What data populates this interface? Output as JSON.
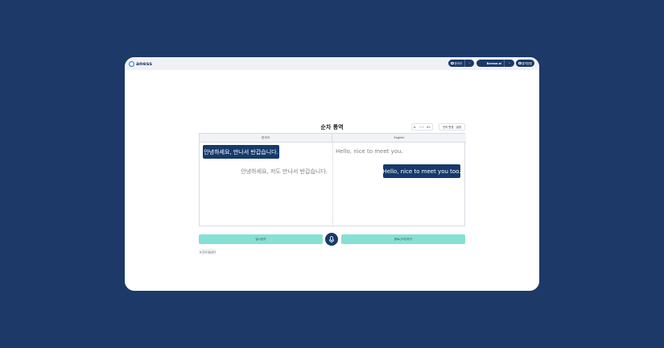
{
  "app": {
    "logo_text": "aness",
    "title": "순차 통역"
  },
  "header": {
    "language_label": "한국어",
    "user_label": "Boreoe.ai",
    "guide_label": "통역방법"
  },
  "controls": {
    "font_decrease": "A-",
    "font_mid": "100",
    "font_increase": "A+",
    "language_change": "언어 변경 · 설정"
  },
  "panel": {
    "left_header": "한국어",
    "right_header": "English",
    "messages": [
      {
        "side": "left",
        "style": "bubble",
        "text": "안녕하세요, 만나서 반갑습니다."
      },
      {
        "side": "right",
        "style": "plain",
        "text": "Hello, nice to meet you."
      },
      {
        "side": "left",
        "style": "plain",
        "text": "안녕하세요, 저도 만나서 반갑습니다."
      },
      {
        "side": "right",
        "style": "bubble",
        "text": "Hello, nice to meet you too."
      }
    ]
  },
  "actions": {
    "left_button": "일시정지",
    "right_button": "종료(고지)하기",
    "small_button": "전사 내보내기"
  },
  "colors": {
    "background": "#1c3968",
    "bubble": "#163a6b",
    "action_button": "#86e0d4"
  }
}
